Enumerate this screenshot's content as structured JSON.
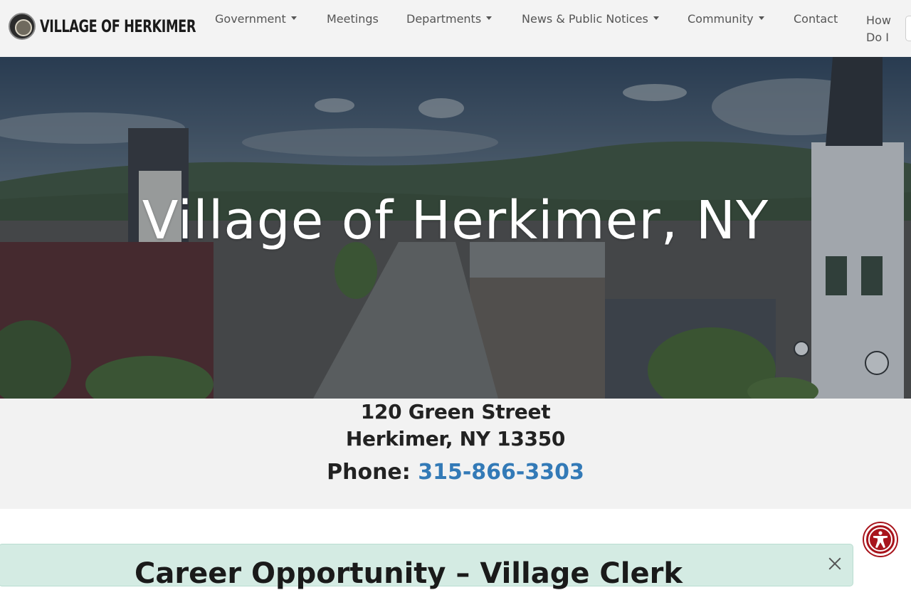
{
  "header": {
    "brand": "VILLAGE OF HERKIMER",
    "nav": [
      {
        "label": "Government",
        "dropdown": true
      },
      {
        "label": "Meetings",
        "dropdown": false
      },
      {
        "label": "Departments",
        "dropdown": true
      },
      {
        "label": "News & Public Notices",
        "dropdown": true
      },
      {
        "label": "Community",
        "dropdown": true
      },
      {
        "label": "Contact",
        "dropdown": false
      }
    ],
    "how_do_i": "How Do I"
  },
  "hero": {
    "title": "Village of Herkimer, NY"
  },
  "contact": {
    "street": "120 Green Street",
    "city": "Herkimer, NY 13350",
    "phone_label": "Phone:",
    "phone": "315-866-3303"
  },
  "alert": {
    "title": "Career Opportunity – Village Clerk"
  },
  "colors": {
    "link": "#337ab7",
    "accessibility": "#a8141c",
    "alert_bg": "#d4ebe3"
  }
}
